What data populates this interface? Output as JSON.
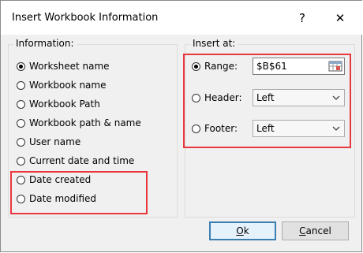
{
  "window": {
    "title": "Insert Workbook Information",
    "help_label": "?",
    "close_label": "✕"
  },
  "information": {
    "label": "Information:",
    "options": [
      {
        "label": "Worksheet name",
        "checked": true
      },
      {
        "label": "Workbook name",
        "checked": false
      },
      {
        "label": "Workbook Path",
        "checked": false
      },
      {
        "label": "Workbook path & name",
        "checked": false
      },
      {
        "label": "User name",
        "checked": false
      },
      {
        "label": "Current date and time",
        "checked": false
      },
      {
        "label": "Date created",
        "checked": false
      },
      {
        "label": "Date modified",
        "checked": false
      }
    ]
  },
  "insert_at": {
    "label": "Insert at:",
    "range": {
      "label": "Range:",
      "value": "$B$61",
      "checked": true
    },
    "header": {
      "label": "Header:",
      "value": "Left",
      "checked": false
    },
    "footer": {
      "label": "Footer:",
      "value": "Left",
      "checked": false
    }
  },
  "buttons": {
    "ok": "Ok",
    "cancel": "Cancel"
  },
  "colors": {
    "highlight": "#e8383d",
    "default_button_border": "#3c7fb1"
  }
}
